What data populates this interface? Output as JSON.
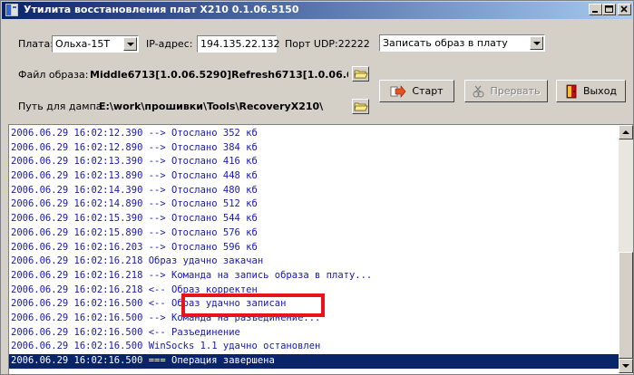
{
  "window": {
    "title": "Утилита восстановления плат X210 0.1.06.5150",
    "minimize": "_",
    "maximize": "□",
    "close": "×"
  },
  "top_row": {
    "board_label": "Плата:",
    "board_value": "Ольха-15T",
    "ip_label": "IP-адрес:",
    "ip_value": "194.135.22.132",
    "port_label": "Порт UDP:22222",
    "action_value": "Записать образ в плату"
  },
  "image_file": {
    "label": "Файл образа:",
    "value": "Middle6713[1.0.06.5290]Refresh6713[1.0.06.622("
  },
  "dump_path": {
    "label": "Путь для дампа:",
    "value": "E:\\work\\прошивки\\Tools\\RecoveryX210\\"
  },
  "buttons": {
    "start": "Старт",
    "abort": "Прервать",
    "exit": "Выход"
  },
  "log": [
    "2006.06.29 16:02:12.390 --> Отослано 352 кб",
    "2006.06.29 16:02:12.890 --> Отослано 384 кб",
    "2006.06.29 16:02:13.390 --> Отослано 416 кб",
    "2006.06.29 16:02:13.890 --> Отослано 448 кб",
    "2006.06.29 16:02:14.390 --> Отослано 480 кб",
    "2006.06.29 16:02:14.890 --> Отослано 512 кб",
    "2006.06.29 16:02:15.390 --> Отослано 544 кб",
    "2006.06.29 16:02:15.890 --> Отослано 576 кб",
    "2006.06.29 16:02:16.203 --> Отослано 596 кб",
    "2006.06.29 16:02:16.218 Образ удачно закачан",
    "2006.06.29 16:02:16.218 --> Команда на запись образа в плату...",
    "2006.06.29 16:02:16.218 <-- Образ корректен",
    "2006.06.29 16:02:16.500 <-- Образ удачно записан",
    "2006.06.29 16:02:16.500 --> Команда на разъединение...",
    "2006.06.29 16:02:16.500 <-- Разъединение",
    "2006.06.29 16:02:16.500 WinSocks 1.1 удачно остановлен",
    "2006.06.29 16:02:16.500 === Операция завершена"
  ],
  "selected_log_index": 16,
  "highlighted_log_index": 12,
  "colors": {
    "log_text": "#1a1aa8",
    "selection": "#0a246a",
    "highlight_border": "#e8141c"
  }
}
